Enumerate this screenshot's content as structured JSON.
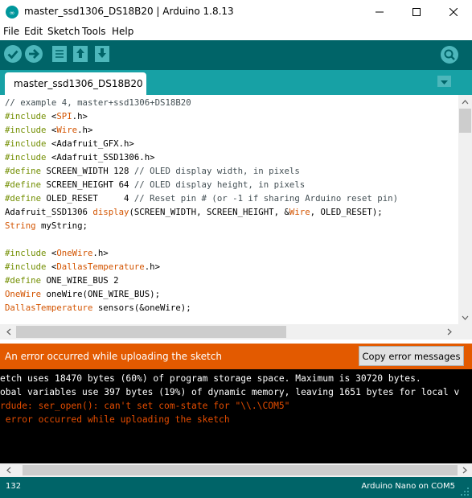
{
  "window": {
    "title": "master_ssd1306_DS18B20 | Arduino 1.8.13"
  },
  "menu": [
    "File",
    "Edit",
    "Sketch",
    "Tools",
    "Help"
  ],
  "toolbar": {
    "verify": "verify-icon",
    "upload": "upload-arrow-icon",
    "new": "new-file-icon",
    "open": "open-icon",
    "save": "save-icon",
    "serial_monitor": "magnifier-icon"
  },
  "tab": {
    "label": "master_ssd1306_DS18B20"
  },
  "code": [
    [
      {
        "t": "// example 4, master+ssd1306+DS18B20",
        "c": "comment"
      }
    ],
    [
      {
        "t": "#include",
        "c": "kw"
      },
      {
        "t": " <",
        "c": ""
      },
      {
        "t": "SPI",
        "c": "ty"
      },
      {
        "t": ".h>",
        "c": ""
      }
    ],
    [
      {
        "t": "#include",
        "c": "kw"
      },
      {
        "t": " <",
        "c": ""
      },
      {
        "t": "Wire",
        "c": "ty"
      },
      {
        "t": ".h>",
        "c": ""
      }
    ],
    [
      {
        "t": "#include",
        "c": "kw"
      },
      {
        "t": " <Adafruit_GFX.h>",
        "c": ""
      }
    ],
    [
      {
        "t": "#include",
        "c": "kw"
      },
      {
        "t": " <Adafruit_SSD1306.h>",
        "c": ""
      }
    ],
    [
      {
        "t": "#define",
        "c": "kw"
      },
      {
        "t": " SCREEN_WIDTH 128 ",
        "c": ""
      },
      {
        "t": "// OLED display width, in pixels",
        "c": "comment"
      }
    ],
    [
      {
        "t": "#define",
        "c": "kw"
      },
      {
        "t": " SCREEN_HEIGHT 64 ",
        "c": ""
      },
      {
        "t": "// OLED display height, in pixels",
        "c": "comment"
      }
    ],
    [
      {
        "t": "#define",
        "c": "kw"
      },
      {
        "t": " OLED_RESET     4 ",
        "c": ""
      },
      {
        "t": "// Reset pin # (or -1 if sharing Arduino reset pin)",
        "c": "comment"
      }
    ],
    [
      {
        "t": "Adafruit_SSD1306 ",
        "c": ""
      },
      {
        "t": "display",
        "c": "ty"
      },
      {
        "t": "(SCREEN_WIDTH, SCREEN_HEIGHT, &",
        "c": ""
      },
      {
        "t": "Wire",
        "c": "ty"
      },
      {
        "t": ", OLED_RESET);",
        "c": ""
      }
    ],
    [
      {
        "t": "String",
        "c": "ty"
      },
      {
        "t": " myString;",
        "c": ""
      }
    ],
    [
      {
        "t": "",
        "c": ""
      }
    ],
    [
      {
        "t": "#include",
        "c": "kw"
      },
      {
        "t": " <",
        "c": ""
      },
      {
        "t": "OneWire",
        "c": "ty"
      },
      {
        "t": ".h>",
        "c": ""
      }
    ],
    [
      {
        "t": "#include",
        "c": "kw"
      },
      {
        "t": " <",
        "c": ""
      },
      {
        "t": "DallasTemperature",
        "c": "ty"
      },
      {
        "t": ".h>",
        "c": ""
      }
    ],
    [
      {
        "t": "#define",
        "c": "kw"
      },
      {
        "t": " ONE_WIRE_BUS 2",
        "c": ""
      }
    ],
    [
      {
        "t": "OneWire",
        "c": "ty"
      },
      {
        "t": " oneWire(ONE_WIRE_BUS);",
        "c": ""
      }
    ],
    [
      {
        "t": "DallasTemperature",
        "c": "ty"
      },
      {
        "t": " sensors(&oneWire);",
        "c": ""
      }
    ]
  ],
  "status": {
    "message": "An error occurred while uploading the sketch",
    "copy_button": "Copy error messages",
    "bar_color": "#e35a00"
  },
  "console": [
    {
      "text": "etch uses 18470 bytes (60%) of program storage space. Maximum is 30720 bytes.",
      "color": "white"
    },
    {
      "text": "obal variables use 397 bytes (19%) of dynamic memory, leaving 1651 bytes for local v",
      "color": "white"
    },
    {
      "text": "rdude: ser_open(): can't set com-state for \"\\\\.\\COM5\"",
      "color": "red"
    },
    {
      "text": " error occurred while uploading the sketch",
      "color": "red"
    }
  ],
  "footer": {
    "line": "132",
    "board": "Arduino Nano on COM5"
  },
  "colors": {
    "toolbar": "#006468",
    "tabbar": "#17a1a5",
    "keyword": "#728e00",
    "type": "#d35400",
    "comment": "#434f54"
  }
}
